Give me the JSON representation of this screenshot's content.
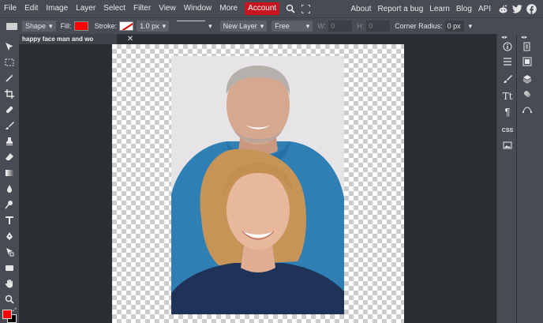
{
  "menu": {
    "items": [
      "File",
      "Edit",
      "Image",
      "Layer",
      "Select",
      "Filter",
      "View",
      "Window",
      "More"
    ],
    "account_label": "Account",
    "right_links": [
      "About",
      "Report a bug",
      "Learn",
      "Blog",
      "API"
    ],
    "social_icons": [
      "reddit-icon",
      "twitter-icon",
      "facebook-icon"
    ]
  },
  "options": {
    "tool_label": "Shape",
    "fill_label": "Fill:",
    "fill_color": "#ff0000",
    "stroke_label": "Stroke:",
    "stroke_width": "1.0 px",
    "layer_mode": "New Layer",
    "constraint": "Free",
    "w_label": "W:",
    "w_value": "0",
    "h_label": "H:",
    "h_value": "0",
    "corner_label": "Corner Radius:",
    "corner_value": "0 px"
  },
  "document": {
    "tab_title": "happy face man and wo",
    "close_glyph": "✕"
  },
  "colors": {
    "foreground": "#ff0000",
    "background": "#000000",
    "accent": "#c8141e"
  }
}
